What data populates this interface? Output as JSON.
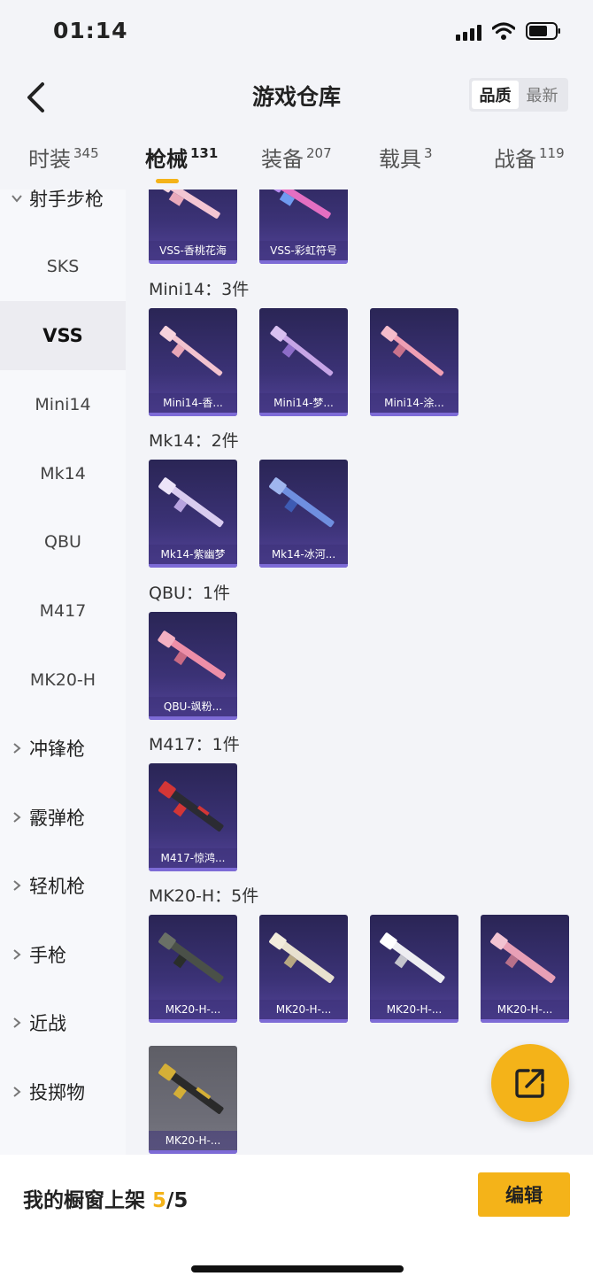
{
  "status_bar": {
    "time": "01:14"
  },
  "header": {
    "title": "游戏仓库",
    "sort_options": [
      "品质",
      "最新"
    ]
  },
  "tabs": [
    {
      "label": "时装",
      "count": "345"
    },
    {
      "label": "枪械",
      "count": "131"
    },
    {
      "label": "装备",
      "count": "207"
    },
    {
      "label": "载具",
      "count": "3"
    },
    {
      "label": "战备",
      "count": "119"
    }
  ],
  "sidebar": {
    "expanded_category": "射手步枪",
    "items": [
      "SKS",
      "VSS",
      "Mini14",
      "Mk14",
      "QBU",
      "M417",
      "MK20-H"
    ],
    "collapsed_categories": [
      "冲锋枪",
      "霰弹枪",
      "轻机枪",
      "手枪",
      "近战",
      "投掷物"
    ]
  },
  "groups": [
    {
      "label": "",
      "items": [
        "VSS-香桃花海",
        "VSS-彩虹符号"
      ]
    },
    {
      "label": "Mini14：3件",
      "items": [
        "Mini14-香...",
        "Mini14-梦...",
        "Mini14-涂..."
      ]
    },
    {
      "label": "Mk14：2件",
      "items": [
        "Mk14-紫幽梦",
        "Mk14-冰河..."
      ]
    },
    {
      "label": "QBU：1件",
      "items": [
        "QBU-飒粉..."
      ]
    },
    {
      "label": "M417：1件",
      "items": [
        "M417-惊鸿..."
      ]
    },
    {
      "label": "MK20-H：5件",
      "items": [
        "MK20-H-...",
        "MK20-H-...",
        "MK20-H-...",
        "MK20-H-...",
        "MK20-H-..."
      ]
    }
  ],
  "footer": {
    "showcase_label": "我的橱窗上架",
    "showcase_current": "5",
    "showcase_total": "/5",
    "edit_label": "编辑"
  },
  "colors": {
    "accent": "#f4b319",
    "card_bg": "#3b3276",
    "page_bg": "#f3f4f8"
  },
  "icons": [
    "back-icon",
    "signal-icon",
    "wifi-icon",
    "battery-icon",
    "chevron-down-icon",
    "chevron-right-icon",
    "gun-icon",
    "share-icon"
  ]
}
